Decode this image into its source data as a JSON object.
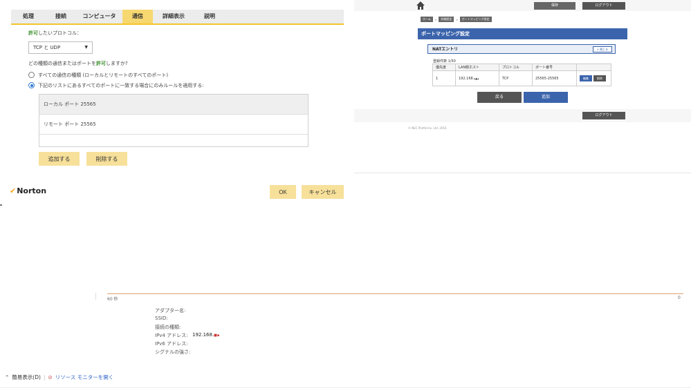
{
  "norton": {
    "tabs": [
      {
        "label": "処理",
        "active": false
      },
      {
        "label": "接続",
        "active": false
      },
      {
        "label": "コンピュータ",
        "active": false
      },
      {
        "label": "通信",
        "active": true
      },
      {
        "label": "詳細表示",
        "active": false
      },
      {
        "label": "説明",
        "active": false
      }
    ],
    "protocol_label_prefix": "許可",
    "protocol_label_suffix": "したいプロトコル：",
    "protocol_value": "TCP と UDP",
    "question_prefix": "どの種類の通信またはポートを",
    "question_emph": "許可",
    "question_suffix": "しますか?",
    "radio_all": "すべての通信の種類 (ローカルとリモートのすべてのポート)",
    "radio_list": "下記のリストにあるすべてのポートに一致する場合にのみルールを適用する:",
    "port_rows": [
      "ローカル ポート 25565",
      "リモート ポート 25565"
    ],
    "add_button": "追加する",
    "delete_button": "削除する",
    "logo_text": "Norton",
    "ok_button": "OK",
    "cancel_button": "キャンセル"
  },
  "router": {
    "top_btn_1": "保存",
    "top_btn_2": "ログアウト",
    "breadcrumb": [
      "ホーム",
      "詳細設定",
      "ポートマッピング設定"
    ],
    "page_title": "ポートマッピング設定",
    "nat_title": "NATエントリ",
    "close_label": "閉じる",
    "count_label": "登録件数 1/50",
    "table_headers": [
      "優先度",
      "LAN側ホスト",
      "プロトコル",
      "ポート番号",
      ""
    ],
    "table_rows": [
      {
        "priority": "1",
        "host": "192.168.",
        "protocol": "TCP",
        "ports": "25565-25565",
        "edit": "編集",
        "delete": "削除"
      }
    ],
    "back_button": "戻る",
    "add_button": "追加",
    "bottom_logout": "ログアウト",
    "copyright": "© NEC Platforms, Ltd. 2016"
  },
  "monitor": {
    "axis_left": "60 秒",
    "axis_right": "0",
    "info_labels": [
      "アダプター名:",
      "SSID:",
      "接続の種類:",
      "IPv4 アドレス:",
      "IPv6 アドレス:",
      "シグナルの強さ:"
    ],
    "ipv4_value": "192.168.",
    "footer_toggle": "簡易表示(D)",
    "footer_link": "リソース モニターを開く"
  },
  "colors": {
    "tab_active": "#f7d870",
    "accent_yellow": "#f3c52a",
    "router_blue": "#3b64ac",
    "router_grey": "#555555",
    "link_blue": "#2e63c7"
  }
}
